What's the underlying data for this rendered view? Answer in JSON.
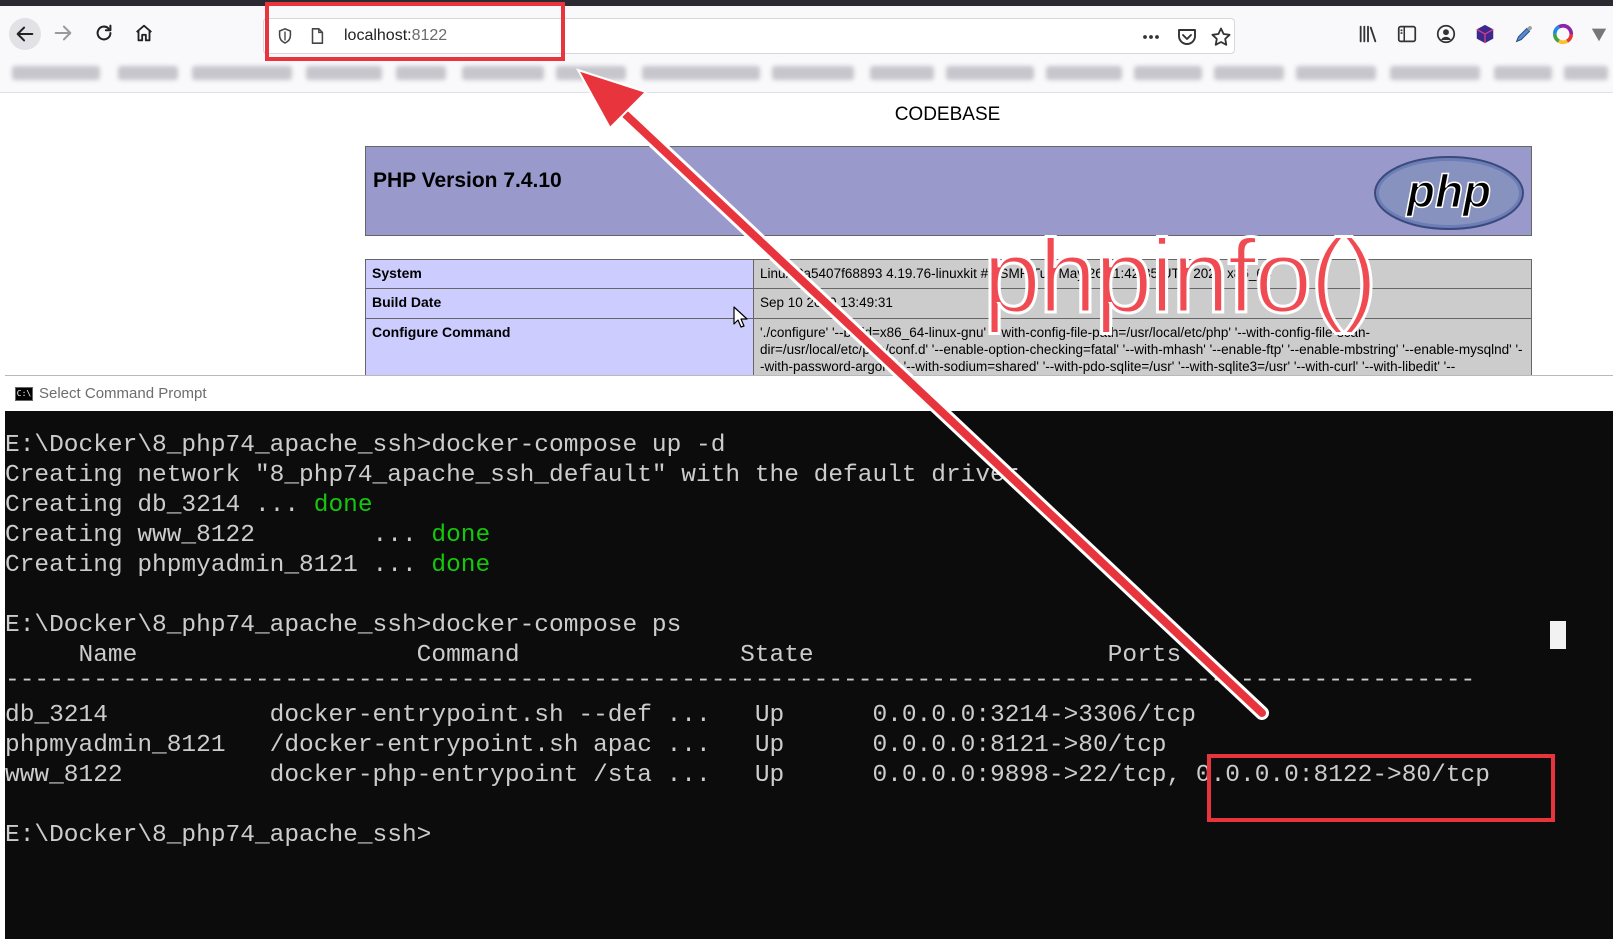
{
  "browser": {
    "url_host": "localhost:",
    "url_port": "8122"
  },
  "page": {
    "heading": "CODEBASE",
    "php_version": "PHP Version 7.4.10",
    "logo_text": "php",
    "rows": [
      {
        "key": "System",
        "value": "Linux 8a5407f68893 4.19.76-linuxkit #1 SMP Tue May 26 11:42:35 UTC 2020 x86_64"
      },
      {
        "key": "Build Date",
        "value": "Sep 10 2020 13:49:31"
      },
      {
        "key": "Configure Command",
        "value": "'./configure' '--build=x86_64-linux-gnu' '--with-config-file-path=/usr/local/etc/php' '--with-config-file-scan-dir=/usr/local/etc/php/conf.d' '--enable-option-checking=fatal' '--with-mhash' '--enable-ftp' '--enable-mbstring' '--enable-mysqlnd' '--with-password-argon2' '--with-sodium=shared' '--with-pdo-sqlite=/usr' '--with-sqlite3=/usr' '--with-curl' '--with-libedit' '--"
      }
    ]
  },
  "cmd": {
    "title": "Select Command Prompt",
    "icon_text": "C:\\",
    "lines": [
      {
        "text": "E:\\Docker\\8_php74_apache_ssh>docker-compose up -d"
      },
      {
        "text": "Creating network \"8_php74_apache_ssh_default\" with the default driver"
      },
      {
        "text": "Creating db_3214 ... ",
        "suffix": "done"
      },
      {
        "text": "Creating www_8122        ... ",
        "suffix": "done"
      },
      {
        "text": "Creating phpmyadmin_8121 ... ",
        "suffix": "done"
      },
      {
        "text": ""
      },
      {
        "text": "E:\\Docker\\8_php74_apache_ssh>docker-compose ps"
      },
      {
        "text": "     Name                   Command               State                    Ports"
      },
      {
        "text": "----------------------------------------------------------------------------------------------------"
      },
      {
        "text": "db_3214           docker-entrypoint.sh --def ...   Up      0.0.0.0:3214->3306/tcp"
      },
      {
        "text": "phpmyadmin_8121   /docker-entrypoint.sh apac ...   Up      0.0.0.0:8121->80/tcp"
      },
      {
        "text": "www_8122          docker-php-entrypoint /sta ...   Up      0.0.0.0:9898->22/tcp, 0.0.0.0:8122->80/tcp"
      },
      {
        "text": ""
      },
      {
        "text": "E:\\Docker\\8_php74_apache_ssh>"
      }
    ]
  },
  "annotation": {
    "label": "phpinfo()",
    "color": "#e8353d"
  }
}
